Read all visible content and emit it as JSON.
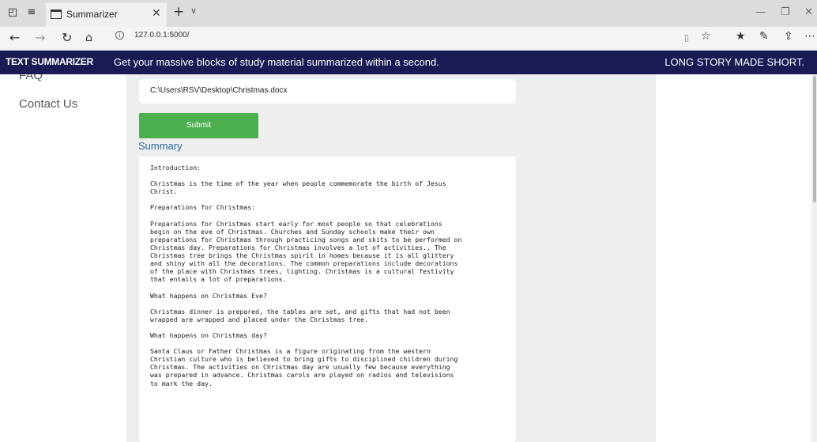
{
  "browser": {
    "tab_title": "Summarizer",
    "url": "127.0.0.1:5000/",
    "icons": [
      "set-aside-tabs-icon",
      "tab-list-icon",
      "tab-page-icon",
      "close-icon",
      "new-tab-icon",
      "chevron-down-icon",
      "back-icon",
      "forward-icon",
      "refresh-icon",
      "home-icon",
      "info-icon",
      "reading-view-icon",
      "favorite-star-icon",
      "favorites-icon",
      "pen-icon",
      "share-icon",
      "more-icon",
      "minimize-icon",
      "restore-icon",
      "window-close-icon"
    ]
  },
  "header": {
    "brand": "TEXT SUMMARIZER",
    "tagline": "Get your massive blocks of study material summarized within a second.",
    "motto": "LONG STORY MADE SHORT."
  },
  "sidebar": {
    "items": [
      {
        "label": "FAQ"
      },
      {
        "label": "Contact Us"
      }
    ]
  },
  "form": {
    "file_path": "C:\\Users\\RSV\\Desktop\\Christmas.docx",
    "submit_label": "Submit"
  },
  "summary": {
    "heading": "Summary",
    "text": "Introduction:\n\nChristmas is the time of the year when people commemorate the birth of Jesus\nChrist.\n\nPreparations for Christmas:\n\nPreparations for Christmas start early for most people so that celebrations\nbegin on the eve of Christmas. Churches and Sunday schools make their own\npreparations for Christmas through practicing songs and skits to be performed on\nChristmas day. Preparations for Christmas involves a lot of activities.. The\nChristmas tree brings the Christmas spirit in homes because it is all glittery\nand shiny with all the decorations. The common preparations include decorations\nof the place with Christmas trees, lighting. Christmas is a cultural festivity\nthat entails a lot of preparations.\n\nWhat happens on Christmas Eve?\n\nChristmas dinner is prepared, the tables are set, and gifts that had not been\nwrapped are wrapped and placed under the Christmas tree.\n\nWhat happens on Christmas day?\n\nSanta Claus or Father Christmas is a figure originating from the western\nChristian culture who is believed to bring gifts to disciplined children during\nChristmas. The activities on Christmas day are usually few because everything\nwas prepared in advance. Christmas carols are played on radios and televisions\nto mark the day."
  }
}
